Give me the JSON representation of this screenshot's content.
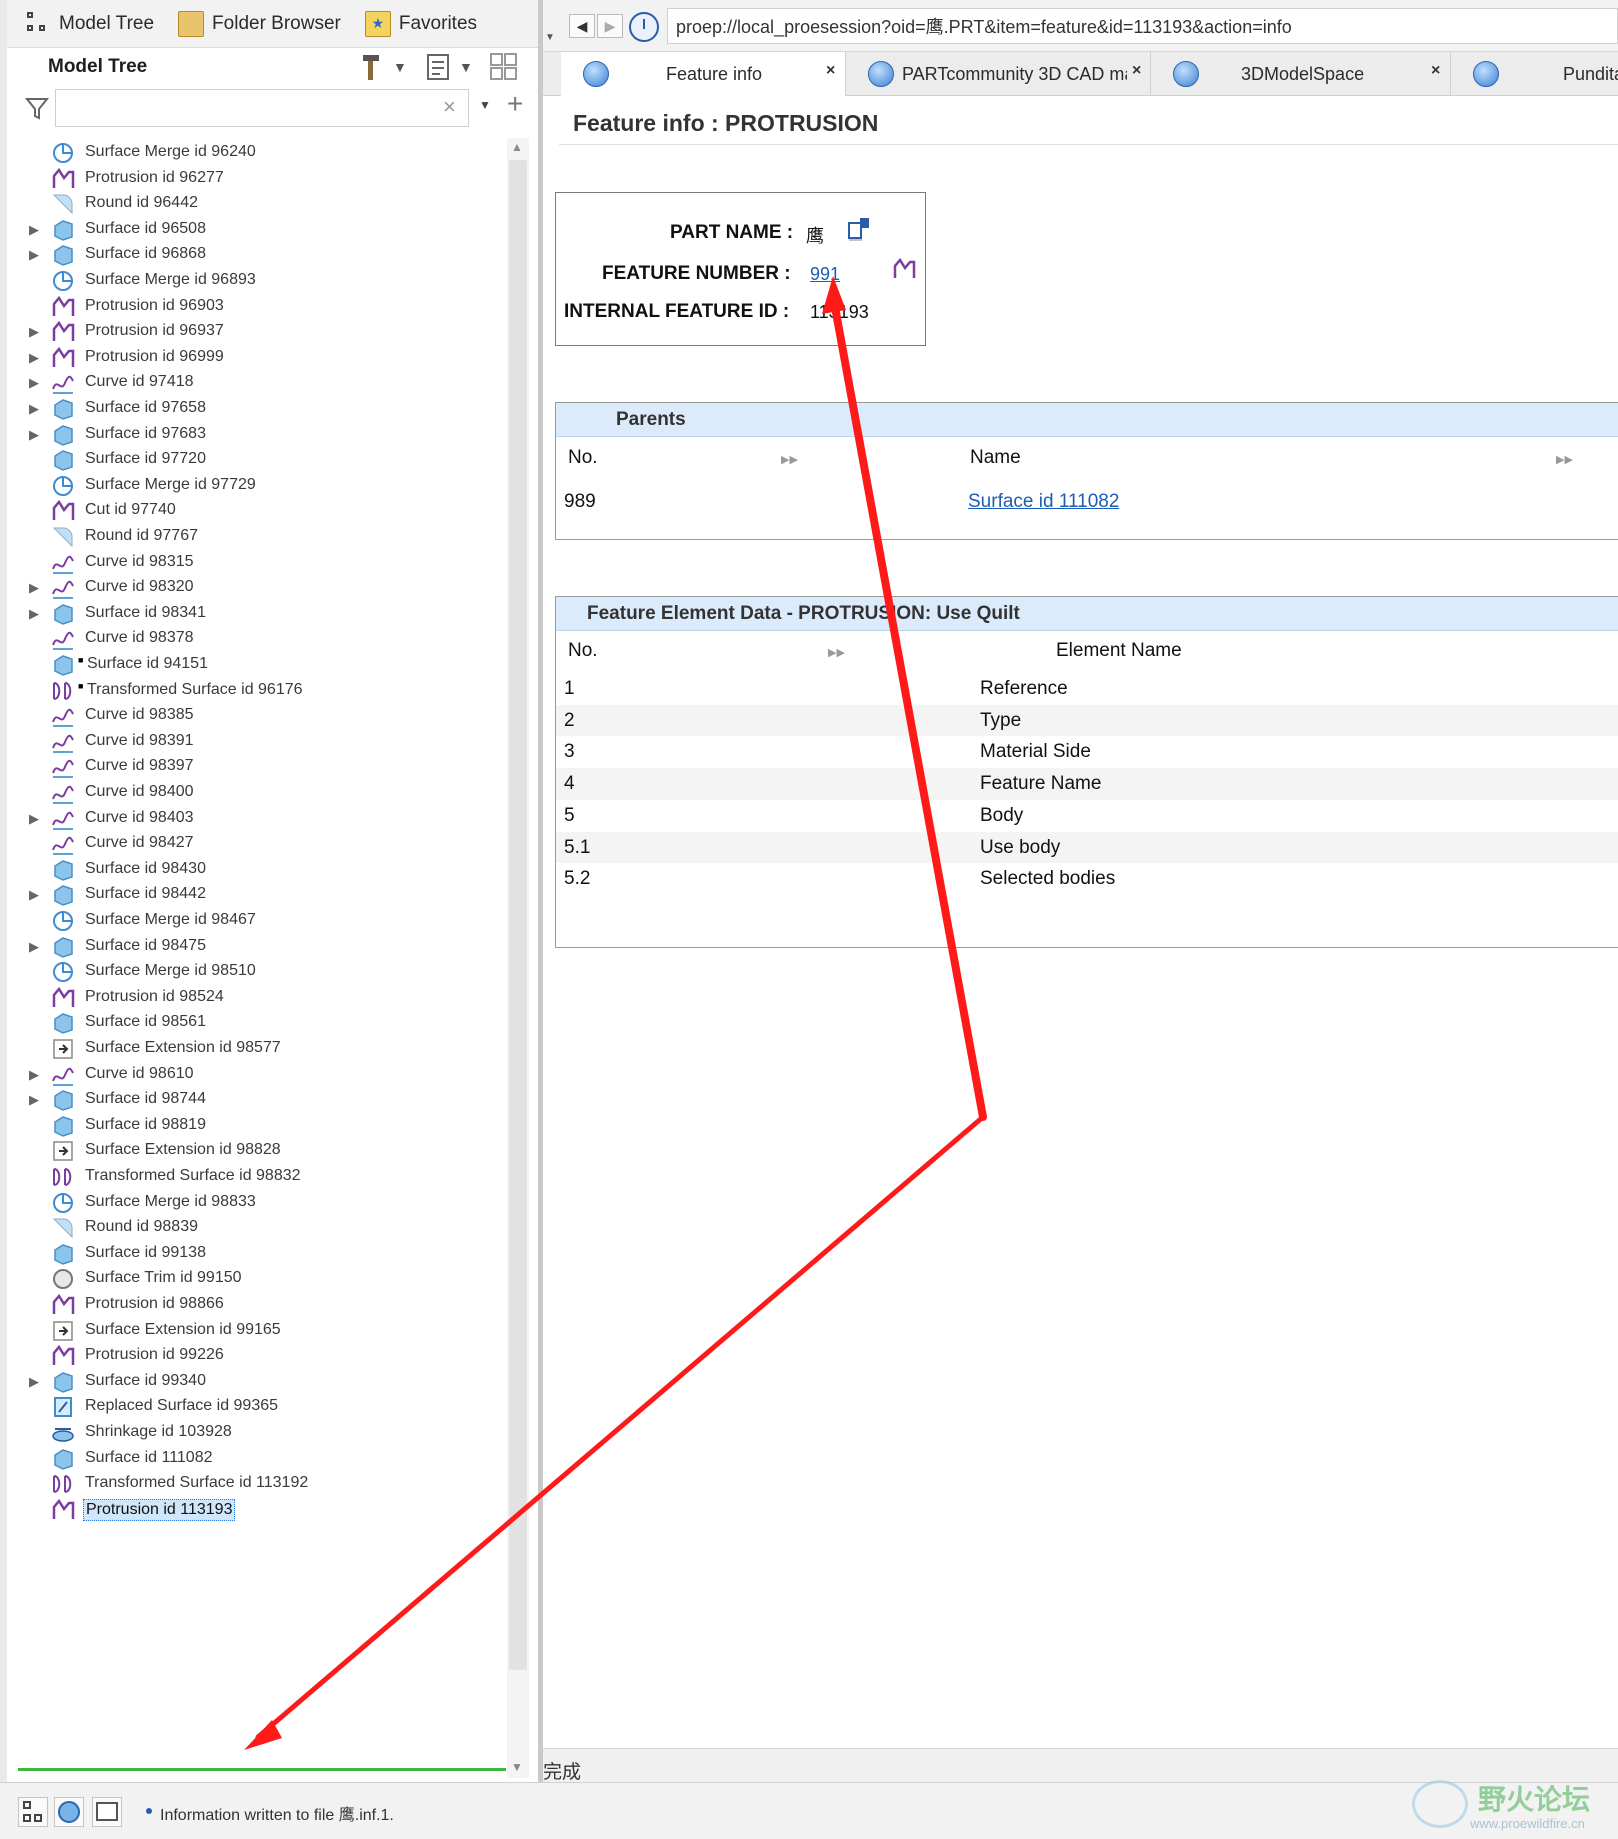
{
  "left_panel": {
    "tabs": [
      {
        "label": "Model Tree",
        "icon": "model-tree-icon"
      },
      {
        "label": "Folder Browser",
        "icon": "folder-icon"
      },
      {
        "label": "Favorites",
        "icon": "favorites-icon"
      }
    ],
    "header_title": "Model Tree",
    "search_placeholder": "",
    "tree_items": [
      {
        "label": "Surface Merge id 96240",
        "icon": "surface-merge-icon",
        "expandable": false
      },
      {
        "label": "Protrusion id 96277",
        "icon": "protrusion-icon",
        "expandable": false
      },
      {
        "label": "Round id 96442",
        "icon": "round-icon",
        "expandable": false
      },
      {
        "label": "Surface id 96508",
        "icon": "surface-icon",
        "expandable": true
      },
      {
        "label": "Surface id 96868",
        "icon": "surface-icon",
        "expandable": true
      },
      {
        "label": "Surface Merge id 96893",
        "icon": "surface-merge-icon",
        "expandable": false
      },
      {
        "label": "Protrusion id 96903",
        "icon": "protrusion-icon",
        "expandable": false
      },
      {
        "label": "Protrusion id 96937",
        "icon": "protrusion-icon",
        "expandable": true
      },
      {
        "label": "Protrusion id 96999",
        "icon": "protrusion-icon",
        "expandable": true
      },
      {
        "label": "Curve id 97418",
        "icon": "curve-icon",
        "expandable": true
      },
      {
        "label": "Surface id 97658",
        "icon": "surface-icon",
        "expandable": true
      },
      {
        "label": "Surface id 97683",
        "icon": "surface-icon",
        "expandable": true
      },
      {
        "label": "Surface id 97720",
        "icon": "surface-icon",
        "expandable": false
      },
      {
        "label": "Surface Merge id 97729",
        "icon": "surface-merge-icon",
        "expandable": false
      },
      {
        "label": "Cut id 97740",
        "icon": "cut-icon",
        "expandable": false
      },
      {
        "label": "Round id 97767",
        "icon": "round-icon",
        "expandable": false
      },
      {
        "label": "Curve id 98315",
        "icon": "curve-icon",
        "expandable": false
      },
      {
        "label": "Curve id 98320",
        "icon": "curve-icon",
        "expandable": true
      },
      {
        "label": "Surface id 98341",
        "icon": "surface-icon",
        "expandable": true
      },
      {
        "label": "Curve id 98378",
        "icon": "curve-icon",
        "expandable": false
      },
      {
        "label": "Surface id 94151",
        "icon": "surface-icon",
        "expandable": false,
        "marked": true
      },
      {
        "label": "Transformed Surface id 96176",
        "icon": "transformed-surface-icon",
        "expandable": false,
        "marked": true
      },
      {
        "label": "Curve id 98385",
        "icon": "curve-icon",
        "expandable": false
      },
      {
        "label": "Curve id 98391",
        "icon": "curve-icon",
        "expandable": false
      },
      {
        "label": "Curve id 98397",
        "icon": "curve-icon",
        "expandable": false
      },
      {
        "label": "Curve id 98400",
        "icon": "curve-icon",
        "expandable": false
      },
      {
        "label": "Curve id 98403",
        "icon": "curve-icon",
        "expandable": true
      },
      {
        "label": "Curve id 98427",
        "icon": "curve-icon",
        "expandable": false
      },
      {
        "label": "Surface id 98430",
        "icon": "surface-icon",
        "expandable": false
      },
      {
        "label": "Surface id 98442",
        "icon": "surface-icon",
        "expandable": true
      },
      {
        "label": "Surface Merge id 98467",
        "icon": "surface-merge-icon",
        "expandable": false
      },
      {
        "label": "Surface id 98475",
        "icon": "surface-icon",
        "expandable": true
      },
      {
        "label": "Surface Merge id 98510",
        "icon": "surface-merge-icon",
        "expandable": false
      },
      {
        "label": "Protrusion id 98524",
        "icon": "protrusion-icon",
        "expandable": false
      },
      {
        "label": "Surface id 98561",
        "icon": "surface-icon",
        "expandable": false
      },
      {
        "label": "Surface Extension id 98577",
        "icon": "surface-extension-icon",
        "expandable": false
      },
      {
        "label": "Curve id 98610",
        "icon": "curve-icon",
        "expandable": true
      },
      {
        "label": "Surface id 98744",
        "icon": "surface-icon",
        "expandable": true
      },
      {
        "label": "Surface id 98819",
        "icon": "surface-icon",
        "expandable": false
      },
      {
        "label": "Surface Extension id 98828",
        "icon": "surface-extension-icon",
        "expandable": false
      },
      {
        "label": "Transformed Surface id 98832",
        "icon": "transformed-surface-icon",
        "expandable": false
      },
      {
        "label": "Surface Merge id 98833",
        "icon": "surface-merge-icon",
        "expandable": false
      },
      {
        "label": "Round id 98839",
        "icon": "round-icon",
        "expandable": false
      },
      {
        "label": "Surface id 99138",
        "icon": "surface-icon",
        "expandable": false
      },
      {
        "label": "Surface Trim id 99150",
        "icon": "surface-trim-icon",
        "expandable": false
      },
      {
        "label": "Protrusion id 98866",
        "icon": "protrusion-icon",
        "expandable": false
      },
      {
        "label": "Surface Extension id 99165",
        "icon": "surface-extension-icon",
        "expandable": false
      },
      {
        "label": "Protrusion id 99226",
        "icon": "protrusion-icon",
        "expandable": false
      },
      {
        "label": "Surface id 99340",
        "icon": "surface-icon",
        "expandable": true
      },
      {
        "label": "Replaced Surface id 99365",
        "icon": "replaced-surface-icon",
        "expandable": false
      },
      {
        "label": "Shrinkage id 103928",
        "icon": "shrinkage-icon",
        "expandable": false
      },
      {
        "label": "Surface id 111082",
        "icon": "surface-icon",
        "expandable": false
      },
      {
        "label": "Transformed Surface id 113192",
        "icon": "transformed-surface-icon",
        "expandable": false
      },
      {
        "label": "Protrusion id 113193",
        "icon": "protrusion-icon",
        "expandable": false,
        "selected": true
      }
    ]
  },
  "browser": {
    "url": "proep://local_proesession?oid=鹰.PRT&item=feature&id=113193&action=info",
    "tabs": [
      {
        "label": "Feature info",
        "active": true
      },
      {
        "label": "PARTcommunity 3D CAD ma",
        "active": false
      },
      {
        "label": "3DModelSpace",
        "active": false
      },
      {
        "label": "Pundita",
        "active": false
      }
    ],
    "status": "完成"
  },
  "feature_info": {
    "title": "Feature info : PROTRUSION",
    "part_name_label": "PART NAME :",
    "part_name": "鹰",
    "feature_number_label": "FEATURE NUMBER :",
    "feature_number": "991",
    "internal_id_label": "INTERNAL FEATURE ID :",
    "internal_id": "113193"
  },
  "parents": {
    "title": "Parents",
    "columns": [
      "No.",
      "Name"
    ],
    "rows": [
      {
        "no": "989",
        "name": "Surface id 111082"
      }
    ]
  },
  "element_data": {
    "title": "Feature Element Data - PROTRUSION: Use Quilt",
    "columns": [
      "No.",
      "Element Name"
    ],
    "rows": [
      {
        "no": "1",
        "name": "Reference"
      },
      {
        "no": "2",
        "name": "Type"
      },
      {
        "no": "3",
        "name": "Material Side"
      },
      {
        "no": "4",
        "name": "Feature Name"
      },
      {
        "no": "5",
        "name": "Body"
      },
      {
        "no": "5.1",
        "name": "Use body"
      },
      {
        "no": "5.2",
        "name": "Selected bodies"
      }
    ]
  },
  "statusbar": {
    "message": "Information written to file 鹰.inf.1."
  },
  "watermark": {
    "text": "野火论坛",
    "url": "www.proewildfire.cn"
  },
  "colors": {
    "annotation_arrow": "#ff1a1a",
    "link": "#1a5fb4",
    "section_header": "#dcebfb",
    "selection": "#cfe6fb",
    "tree_icon": "#7a3ea1",
    "surface_icon": "#5aa2d8"
  }
}
